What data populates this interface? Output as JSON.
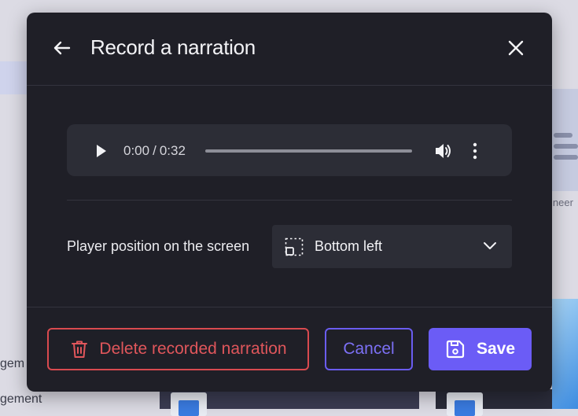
{
  "background": {
    "left_texts": [
      "gem",
      "gement"
    ],
    "right_text": "ineer"
  },
  "dialog": {
    "title": "Record a narration",
    "back_icon": "arrow-left-icon",
    "close_icon": "close-icon"
  },
  "player": {
    "current_time": "0:00",
    "separator": "/",
    "duration": "0:32",
    "progress": 0,
    "icons": [
      "play-icon",
      "volume-icon",
      "more-vertical-icon"
    ]
  },
  "position": {
    "label": "Player position on the screen",
    "selected": "Bottom left",
    "icon": "position-bottom-left-icon"
  },
  "actions": {
    "delete_label": "Delete recorded narration",
    "cancel_label": "Cancel",
    "save_label": "Save"
  },
  "colors": {
    "modal_bg": "#1f1f27",
    "danger": "#d94a4f",
    "accent": "#6b5cf6"
  }
}
